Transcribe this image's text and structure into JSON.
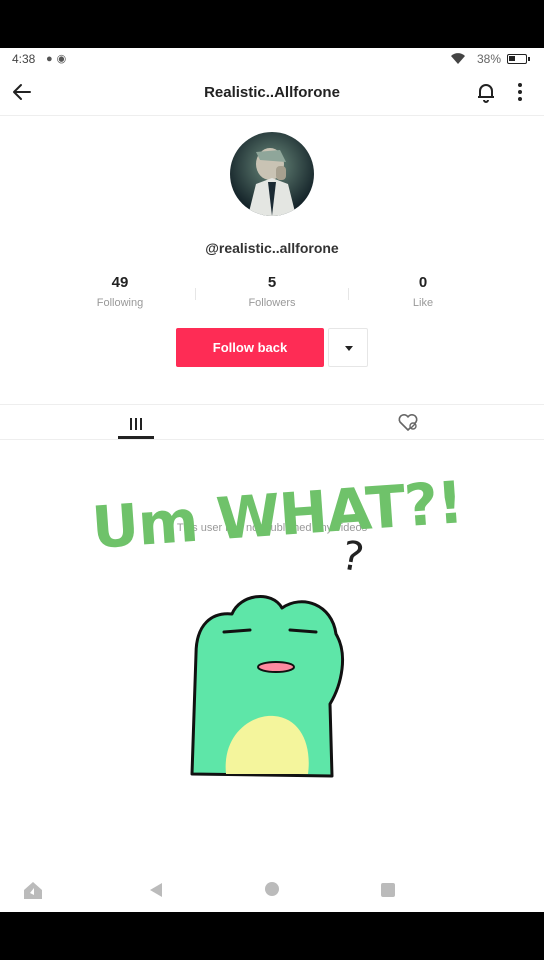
{
  "status_bar": {
    "time": "4:38",
    "notification_icons": [
      "chat-icon",
      "incognito-icon"
    ],
    "battery_percent": "38%"
  },
  "header": {
    "title": "Realistic..Allforone",
    "icons": [
      "back-arrow-icon",
      "bell-icon",
      "more-vertical-icon"
    ]
  },
  "profile": {
    "handle": "@realistic..allforone",
    "stats": [
      {
        "value": "49",
        "label": "Following"
      },
      {
        "value": "5",
        "label": "Followers"
      },
      {
        "value": "0",
        "label": "Like"
      }
    ],
    "follow_button_label": "Follow back"
  },
  "tabs": [
    "videos-grid-icon",
    "liked-heart-icon"
  ],
  "empty_message": "This user has not published any videos",
  "overlay": {
    "text": "Um WHAT?!",
    "question_mark": "?",
    "text_color": "#6fc26a"
  },
  "colors": {
    "accent": "#fe2c55"
  },
  "nav_bar": [
    "home-icon",
    "back-icon",
    "home-circle-icon",
    "recents-icon"
  ]
}
